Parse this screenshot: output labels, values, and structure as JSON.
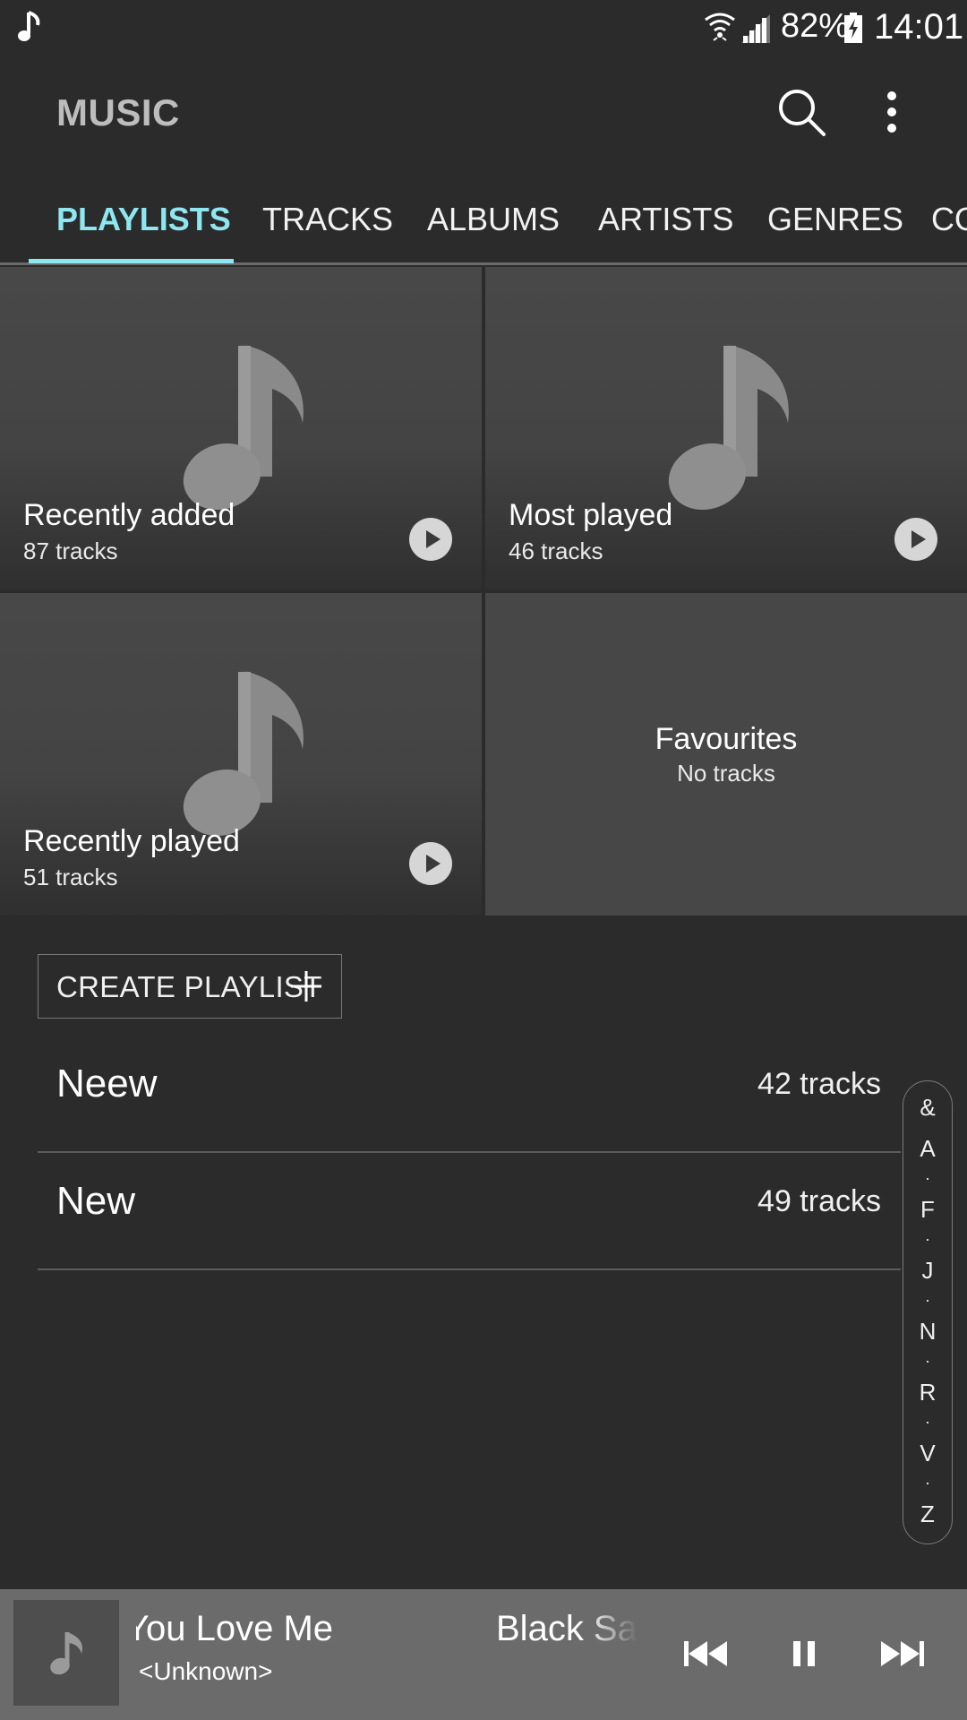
{
  "status_bar": {
    "battery_percent": "82%",
    "time": "14:01",
    "icons": [
      "music-note-icon",
      "wifi-icon",
      "signal-icon",
      "battery-charging-icon"
    ]
  },
  "app_bar": {
    "title": "MUSIC",
    "icons": [
      "search-icon",
      "more-vert-icon"
    ]
  },
  "tabs": [
    {
      "label": "PLAYLISTS",
      "active": true
    },
    {
      "label": "TRACKS",
      "active": false
    },
    {
      "label": "ALBUMS",
      "active": false
    },
    {
      "label": "ARTISTS",
      "active": false
    },
    {
      "label": "GENRES",
      "active": false
    },
    {
      "label": "CO",
      "active": false
    }
  ],
  "playlist_tiles": [
    {
      "name": "Recently added",
      "count": "87 tracks"
    },
    {
      "name": "Most played",
      "count": "46 tracks"
    },
    {
      "name": "Recently played",
      "count": "51 tracks"
    },
    {
      "name": "Favourites",
      "count": "No tracks"
    }
  ],
  "create_playlist": {
    "label": "CREATE PLAYLIST"
  },
  "playlists": [
    {
      "name": "Neew",
      "count": "42 tracks"
    },
    {
      "name": "New",
      "count": "49 tracks"
    }
  ],
  "index_scroller": [
    "&",
    "A",
    "·",
    "F",
    "·",
    "J",
    "·",
    "N",
    "·",
    "R",
    "·",
    "V",
    "·",
    "Z"
  ],
  "mini_player": {
    "title": "You Love Me",
    "title_next": "Black Sai",
    "artist": "<Unknown>",
    "controls": [
      "previous-icon",
      "pause-icon",
      "next-icon"
    ]
  },
  "colors": {
    "accent": "#8ee6f0",
    "background": "#2b2b2b",
    "player_bar": "#6b6b6b"
  }
}
